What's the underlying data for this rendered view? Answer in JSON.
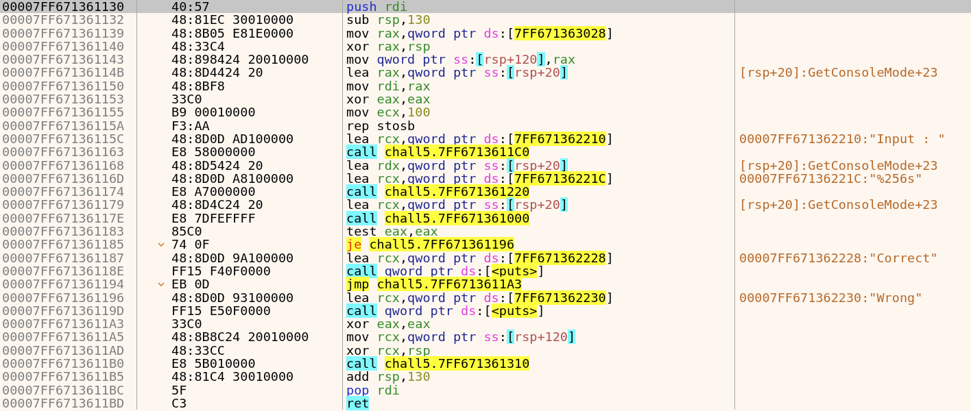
{
  "rows": [
    {
      "address": "00007FF671361130",
      "bytes": "40:57",
      "branch": false,
      "selected": true,
      "instruction": [
        {
          "text": "push",
          "kind": "stack"
        },
        {
          "text": "rdi",
          "kind": "reg",
          "gap": true
        }
      ]
    },
    {
      "address": "00007FF671361132",
      "bytes": "48:81EC 30010000",
      "branch": false,
      "selected": false,
      "instruction": [
        {
          "text": "sub",
          "kind": "mnem"
        },
        {
          "text": "rsp",
          "kind": "reg",
          "gap": true
        },
        {
          "text": ",",
          "kind": "plain"
        },
        {
          "text": "130",
          "kind": "num"
        }
      ]
    },
    {
      "address": "00007FF671361139",
      "bytes": "48:8B05 E81E0000",
      "branch": false,
      "selected": false,
      "instruction": [
        {
          "text": "mov",
          "kind": "mnem"
        },
        {
          "text": "rax",
          "kind": "reg",
          "gap": true
        },
        {
          "text": ",",
          "kind": "plain"
        },
        {
          "text": "qword ptr",
          "kind": "size"
        },
        {
          "text": "ds",
          "kind": "seg",
          "gap": true
        },
        {
          "text": ":[",
          "kind": "plain"
        },
        {
          "text": "7FF671363028",
          "kind": "addr"
        },
        {
          "text": "]",
          "kind": "plain"
        }
      ]
    },
    {
      "address": "00007FF671361140",
      "bytes": "48:33C4",
      "branch": false,
      "selected": false,
      "instruction": [
        {
          "text": "xor",
          "kind": "mnem"
        },
        {
          "text": "rax",
          "kind": "reg",
          "gap": true
        },
        {
          "text": ",",
          "kind": "plain"
        },
        {
          "text": "rsp",
          "kind": "reg"
        }
      ]
    },
    {
      "address": "00007FF671361143",
      "bytes": "48:898424 20010000",
      "branch": false,
      "selected": false,
      "instruction": [
        {
          "text": "mov",
          "kind": "mnem"
        },
        {
          "text": "qword ptr",
          "kind": "size",
          "gap": true
        },
        {
          "text": "ss",
          "kind": "seg",
          "gap": true
        },
        {
          "text": ":",
          "kind": "plain"
        },
        {
          "text": "[",
          "kind": "brk"
        },
        {
          "text": "rsp+120",
          "kind": "mem"
        },
        {
          "text": "]",
          "kind": "brk"
        },
        {
          "text": ",",
          "kind": "plain"
        },
        {
          "text": "rax",
          "kind": "reg"
        }
      ]
    },
    {
      "address": "00007FF67136114B",
      "bytes": "48:8D4424 20",
      "branch": false,
      "selected": false,
      "comment": "[rsp+20]:GetConsoleMode+23",
      "instruction": [
        {
          "text": "lea",
          "kind": "mnem"
        },
        {
          "text": "rax",
          "kind": "reg",
          "gap": true
        },
        {
          "text": ",",
          "kind": "plain"
        },
        {
          "text": "qword ptr",
          "kind": "size"
        },
        {
          "text": "ss",
          "kind": "seg",
          "gap": true
        },
        {
          "text": ":",
          "kind": "plain"
        },
        {
          "text": "[",
          "kind": "brk"
        },
        {
          "text": "rsp+20",
          "kind": "mem"
        },
        {
          "text": "]",
          "kind": "brk"
        }
      ]
    },
    {
      "address": "00007FF671361150",
      "bytes": "48:8BF8",
      "branch": false,
      "selected": false,
      "instruction": [
        {
          "text": "mov",
          "kind": "mnem"
        },
        {
          "text": "rdi",
          "kind": "reg",
          "gap": true
        },
        {
          "text": ",",
          "kind": "plain"
        },
        {
          "text": "rax",
          "kind": "reg"
        }
      ]
    },
    {
      "address": "00007FF671361153",
      "bytes": "33C0",
      "branch": false,
      "selected": false,
      "instruction": [
        {
          "text": "xor",
          "kind": "mnem"
        },
        {
          "text": "eax",
          "kind": "reg",
          "gap": true
        },
        {
          "text": ",",
          "kind": "plain"
        },
        {
          "text": "eax",
          "kind": "reg"
        }
      ]
    },
    {
      "address": "00007FF671361155",
      "bytes": "B9 00010000",
      "branch": false,
      "selected": false,
      "instruction": [
        {
          "text": "mov",
          "kind": "mnem"
        },
        {
          "text": "ecx",
          "kind": "reg",
          "gap": true
        },
        {
          "text": ",",
          "kind": "plain"
        },
        {
          "text": "100",
          "kind": "num"
        }
      ]
    },
    {
      "address": "00007FF67136115A",
      "bytes": "F3:AA",
      "branch": false,
      "selected": false,
      "instruction": [
        {
          "text": "rep stosb",
          "kind": "mnem"
        }
      ]
    },
    {
      "address": "00007FF67136115C",
      "bytes": "48:8D0D AD100000",
      "branch": false,
      "selected": false,
      "comment": "00007FF671362210:\"Input : \"",
      "instruction": [
        {
          "text": "lea",
          "kind": "mnem"
        },
        {
          "text": "rcx",
          "kind": "reg",
          "gap": true
        },
        {
          "text": ",",
          "kind": "plain"
        },
        {
          "text": "qword ptr",
          "kind": "size"
        },
        {
          "text": "ds",
          "kind": "seg",
          "gap": true
        },
        {
          "text": ":[",
          "kind": "plain"
        },
        {
          "text": "7FF671362210",
          "kind": "addr"
        },
        {
          "text": "]",
          "kind": "plain"
        }
      ]
    },
    {
      "address": "00007FF671361163",
      "bytes": "E8 58000000",
      "branch": false,
      "selected": false,
      "instruction": [
        {
          "text": "call",
          "kind": "call"
        },
        {
          "text": "chall5.7FF6713611C0",
          "kind": "label",
          "gap": true
        }
      ]
    },
    {
      "address": "00007FF671361168",
      "bytes": "48:8D5424 20",
      "branch": false,
      "selected": false,
      "comment": "[rsp+20]:GetConsoleMode+23",
      "instruction": [
        {
          "text": "lea",
          "kind": "mnem"
        },
        {
          "text": "rdx",
          "kind": "reg",
          "gap": true
        },
        {
          "text": ",",
          "kind": "plain"
        },
        {
          "text": "qword ptr",
          "kind": "size"
        },
        {
          "text": "ss",
          "kind": "seg",
          "gap": true
        },
        {
          "text": ":",
          "kind": "plain"
        },
        {
          "text": "[",
          "kind": "brk"
        },
        {
          "text": "rsp+20",
          "kind": "mem"
        },
        {
          "text": "]",
          "kind": "brk"
        }
      ]
    },
    {
      "address": "00007FF67136116D",
      "bytes": "48:8D0D A8100000",
      "branch": false,
      "selected": false,
      "comment": "00007FF67136221C:\"%256s\"",
      "instruction": [
        {
          "text": "lea",
          "kind": "mnem"
        },
        {
          "text": "rcx",
          "kind": "reg",
          "gap": true
        },
        {
          "text": ",",
          "kind": "plain"
        },
        {
          "text": "qword ptr",
          "kind": "size"
        },
        {
          "text": "ds",
          "kind": "seg",
          "gap": true
        },
        {
          "text": ":[",
          "kind": "plain"
        },
        {
          "text": "7FF67136221C",
          "kind": "addr"
        },
        {
          "text": "]",
          "kind": "plain"
        }
      ]
    },
    {
      "address": "00007FF671361174",
      "bytes": "E8 A7000000",
      "branch": false,
      "selected": false,
      "instruction": [
        {
          "text": "call",
          "kind": "call"
        },
        {
          "text": "chall5.7FF671361220",
          "kind": "label",
          "gap": true
        }
      ]
    },
    {
      "address": "00007FF671361179",
      "bytes": "48:8D4C24 20",
      "branch": false,
      "selected": false,
      "comment": "[rsp+20]:GetConsoleMode+23",
      "instruction": [
        {
          "text": "lea",
          "kind": "mnem"
        },
        {
          "text": "rcx",
          "kind": "reg",
          "gap": true
        },
        {
          "text": ",",
          "kind": "plain"
        },
        {
          "text": "qword ptr",
          "kind": "size"
        },
        {
          "text": "ss",
          "kind": "seg",
          "gap": true
        },
        {
          "text": ":",
          "kind": "plain"
        },
        {
          "text": "[",
          "kind": "brk"
        },
        {
          "text": "rsp+20",
          "kind": "mem"
        },
        {
          "text": "]",
          "kind": "brk"
        }
      ]
    },
    {
      "address": "00007FF67136117E",
      "bytes": "E8 7DFEFFFF",
      "branch": false,
      "selected": false,
      "instruction": [
        {
          "text": "call",
          "kind": "call"
        },
        {
          "text": "chall5.7FF671361000",
          "kind": "label",
          "gap": true
        }
      ]
    },
    {
      "address": "00007FF671361183",
      "bytes": "85C0",
      "branch": false,
      "selected": false,
      "instruction": [
        {
          "text": "test",
          "kind": "mnem"
        },
        {
          "text": "eax",
          "kind": "reg",
          "gap": true
        },
        {
          "text": ",",
          "kind": "plain"
        },
        {
          "text": "eax",
          "kind": "reg"
        }
      ]
    },
    {
      "address": "00007FF671361185",
      "bytes": "74 0F",
      "branch": true,
      "selected": false,
      "instruction": [
        {
          "text": "je",
          "kind": "cond"
        },
        {
          "text": "chall5.7FF671361196",
          "kind": "label",
          "gap": true
        }
      ]
    },
    {
      "address": "00007FF671361187",
      "bytes": "48:8D0D 9A100000",
      "branch": false,
      "selected": false,
      "comment": "00007FF671362228:\"Correct\"",
      "instruction": [
        {
          "text": "lea",
          "kind": "mnem"
        },
        {
          "text": "rcx",
          "kind": "reg",
          "gap": true
        },
        {
          "text": ",",
          "kind": "plain"
        },
        {
          "text": "qword ptr",
          "kind": "size"
        },
        {
          "text": "ds",
          "kind": "seg",
          "gap": true
        },
        {
          "text": ":[",
          "kind": "plain"
        },
        {
          "text": "7FF671362228",
          "kind": "addr"
        },
        {
          "text": "]",
          "kind": "plain"
        }
      ]
    },
    {
      "address": "00007FF67136118E",
      "bytes": "FF15 F40F0000",
      "branch": false,
      "selected": false,
      "instruction": [
        {
          "text": "call",
          "kind": "call"
        },
        {
          "text": "qword ptr",
          "kind": "size",
          "gap": true
        },
        {
          "text": "ds",
          "kind": "seg",
          "gap": true
        },
        {
          "text": ":[",
          "kind": "plain"
        },
        {
          "text": "<puts>",
          "kind": "label"
        },
        {
          "text": "]",
          "kind": "plain"
        }
      ]
    },
    {
      "address": "00007FF671361194",
      "bytes": "EB 0D",
      "branch": true,
      "selected": false,
      "instruction": [
        {
          "text": "jmp",
          "kind": "jump"
        },
        {
          "text": "chall5.7FF6713611A3",
          "kind": "label",
          "gap": true
        }
      ]
    },
    {
      "address": "00007FF671361196",
      "bytes": "48:8D0D 93100000",
      "branch": false,
      "selected": false,
      "comment": "00007FF671362230:\"Wrong\"",
      "instruction": [
        {
          "text": "lea",
          "kind": "mnem"
        },
        {
          "text": "rcx",
          "kind": "reg",
          "gap": true
        },
        {
          "text": ",",
          "kind": "plain"
        },
        {
          "text": "qword ptr",
          "kind": "size"
        },
        {
          "text": "ds",
          "kind": "seg",
          "gap": true
        },
        {
          "text": ":[",
          "kind": "plain"
        },
        {
          "text": "7FF671362230",
          "kind": "addr"
        },
        {
          "text": "]",
          "kind": "plain"
        }
      ]
    },
    {
      "address": "00007FF67136119D",
      "bytes": "FF15 E50F0000",
      "branch": false,
      "selected": false,
      "instruction": [
        {
          "text": "call",
          "kind": "call"
        },
        {
          "text": "qword ptr",
          "kind": "size",
          "gap": true
        },
        {
          "text": "ds",
          "kind": "seg",
          "gap": true
        },
        {
          "text": ":[",
          "kind": "plain"
        },
        {
          "text": "<puts>",
          "kind": "label"
        },
        {
          "text": "]",
          "kind": "plain"
        }
      ]
    },
    {
      "address": "00007FF6713611A3",
      "bytes": "33C0",
      "branch": false,
      "selected": false,
      "instruction": [
        {
          "text": "xor",
          "kind": "mnem"
        },
        {
          "text": "eax",
          "kind": "reg",
          "gap": true
        },
        {
          "text": ",",
          "kind": "plain"
        },
        {
          "text": "eax",
          "kind": "reg"
        }
      ]
    },
    {
      "address": "00007FF6713611A5",
      "bytes": "48:8B8C24 20010000",
      "branch": false,
      "selected": false,
      "instruction": [
        {
          "text": "mov",
          "kind": "mnem"
        },
        {
          "text": "rcx",
          "kind": "reg",
          "gap": true
        },
        {
          "text": ",",
          "kind": "plain"
        },
        {
          "text": "qword ptr",
          "kind": "size"
        },
        {
          "text": "ss",
          "kind": "seg",
          "gap": true
        },
        {
          "text": ":",
          "kind": "plain"
        },
        {
          "text": "[",
          "kind": "brk"
        },
        {
          "text": "rsp+120",
          "kind": "mem"
        },
        {
          "text": "]",
          "kind": "brk"
        }
      ]
    },
    {
      "address": "00007FF6713611AD",
      "bytes": "48:33CC",
      "branch": false,
      "selected": false,
      "instruction": [
        {
          "text": "xor",
          "kind": "mnem"
        },
        {
          "text": "rcx",
          "kind": "reg",
          "gap": true
        },
        {
          "text": ",",
          "kind": "plain"
        },
        {
          "text": "rsp",
          "kind": "reg"
        }
      ]
    },
    {
      "address": "00007FF6713611B0",
      "bytes": "E8 5B010000",
      "branch": false,
      "selected": false,
      "instruction": [
        {
          "text": "call",
          "kind": "call"
        },
        {
          "text": "chall5.7FF671361310",
          "kind": "label",
          "gap": true
        }
      ]
    },
    {
      "address": "00007FF6713611B5",
      "bytes": "48:81C4 30010000",
      "branch": false,
      "selected": false,
      "instruction": [
        {
          "text": "add",
          "kind": "mnem"
        },
        {
          "text": "rsp",
          "kind": "reg",
          "gap": true
        },
        {
          "text": ",",
          "kind": "plain"
        },
        {
          "text": "130",
          "kind": "num"
        }
      ]
    },
    {
      "address": "00007FF6713611BC",
      "bytes": "5F",
      "branch": false,
      "selected": false,
      "instruction": [
        {
          "text": "pop",
          "kind": "stack"
        },
        {
          "text": "rdi",
          "kind": "reg",
          "gap": true
        }
      ]
    },
    {
      "address": "00007FF6713611BD",
      "bytes": "C3",
      "branch": false,
      "selected": false,
      "instruction": [
        {
          "text": "ret",
          "kind": "call"
        }
      ]
    }
  ]
}
